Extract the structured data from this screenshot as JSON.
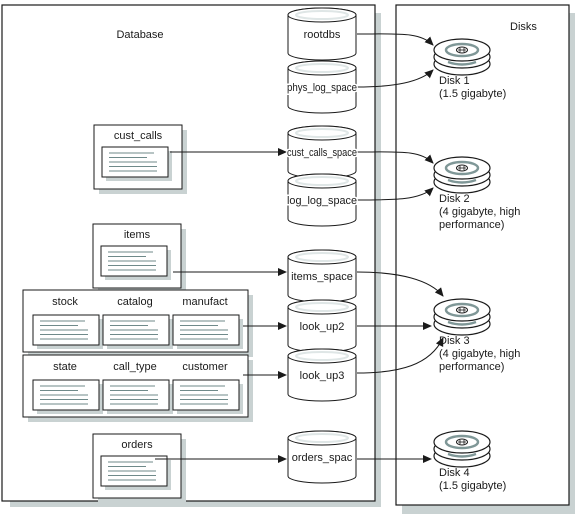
{
  "panels": {
    "database": {
      "title": "Database"
    },
    "disks": {
      "title": "Disks"
    }
  },
  "tables": [
    {
      "id": "cust_calls",
      "label": "cust_calls"
    },
    {
      "id": "items",
      "label": "items"
    },
    {
      "id": "stock",
      "label": "stock"
    },
    {
      "id": "catalog",
      "label": "catalog"
    },
    {
      "id": "manufact",
      "label": "manufact"
    },
    {
      "id": "state",
      "label": "state"
    },
    {
      "id": "call_type",
      "label": "call_type"
    },
    {
      "id": "customer",
      "label": "customer"
    },
    {
      "id": "orders",
      "label": "orders"
    }
  ],
  "dbspaces": [
    {
      "id": "rootdbs",
      "label": "rootdbs"
    },
    {
      "id": "phys_log_space",
      "label": "phys_log_space"
    },
    {
      "id": "cust_calls_space",
      "label": "cust_calls_space"
    },
    {
      "id": "log_log_space",
      "label": "log_log_space"
    },
    {
      "id": "items_space",
      "label": "items_space"
    },
    {
      "id": "look_up2",
      "label": "look_up2"
    },
    {
      "id": "look_up3",
      "label": "look_up3"
    },
    {
      "id": "orders_spac",
      "label": "orders_spac"
    }
  ],
  "disks": [
    {
      "id": "disk1",
      "name": "Disk 1",
      "desc_lines": [
        "(1.5 gigabyte)"
      ]
    },
    {
      "id": "disk2",
      "name": "Disk 2",
      "desc_lines": [
        "(4 gigabyte, high",
        "performance)"
      ]
    },
    {
      "id": "disk3",
      "name": "Disk 3",
      "desc_lines": [
        "(4 gigabyte, high",
        "performance)"
      ]
    },
    {
      "id": "disk4",
      "name": "Disk 4",
      "desc_lines": [
        "(1.5 gigabyte)"
      ]
    }
  ],
  "connections": [
    {
      "from": "cust_calls",
      "to": "cust_calls_space"
    },
    {
      "from": "items",
      "to": "items_space"
    },
    {
      "from": "stock_catalog_manufact",
      "to": "look_up2"
    },
    {
      "from": "state_call_type_customer",
      "to": "look_up3"
    },
    {
      "from": "orders",
      "to": "orders_spac"
    },
    {
      "from": "rootdbs",
      "to": "disk1"
    },
    {
      "from": "phys_log_space",
      "to": "disk1"
    },
    {
      "from": "cust_calls_space",
      "to": "disk2"
    },
    {
      "from": "log_log_space",
      "to": "disk2"
    },
    {
      "from": "items_space",
      "to": "disk3"
    },
    {
      "from": "look_up2",
      "to": "disk3"
    },
    {
      "from": "look_up3",
      "to": "disk3"
    },
    {
      "from": "orders_spac",
      "to": "disk4"
    }
  ],
  "colors": {
    "shadow": "#c9d2d2",
    "line": "#1a1a1a",
    "text_lines": "#6f8a8a",
    "disk_ring": "#7f9797"
  }
}
